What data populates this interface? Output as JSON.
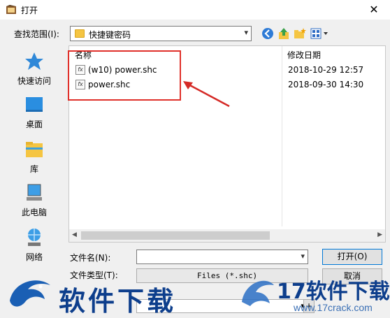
{
  "window": {
    "title": "打开",
    "close_glyph": "✕"
  },
  "lookin": {
    "label": "查找范围(I):",
    "value": "快捷键密码"
  },
  "places": [
    {
      "label": "快速访问",
      "icon": "star-icon"
    },
    {
      "label": "桌面",
      "icon": "desktop-icon"
    },
    {
      "label": "库",
      "icon": "library-icon"
    },
    {
      "label": "此电脑",
      "icon": "computer-icon"
    },
    {
      "label": "网络",
      "icon": "network-icon"
    }
  ],
  "filelist": {
    "columns": {
      "name": "名称",
      "date": "修改日期"
    },
    "rows": [
      {
        "name": "(w10) power.shc",
        "date": "2018-10-29 12:57",
        "icon_label": "fx"
      },
      {
        "name": "power.shc",
        "date": "2018-09-30 14:30",
        "icon_label": "fx"
      }
    ]
  },
  "filename": {
    "label": "文件名(N):",
    "value": ""
  },
  "filetype": {
    "label": "文件类型(T):",
    "value": "Files (*.shc)"
  },
  "buttons": {
    "open": "打开(O)",
    "cancel": "取消",
    "plus": "+"
  },
  "annotation": {
    "color": "#e0302a"
  },
  "watermark": {
    "left_text": "软件下载",
    "right_brand": "17软件下载",
    "right_url": "www.17crack.com"
  }
}
